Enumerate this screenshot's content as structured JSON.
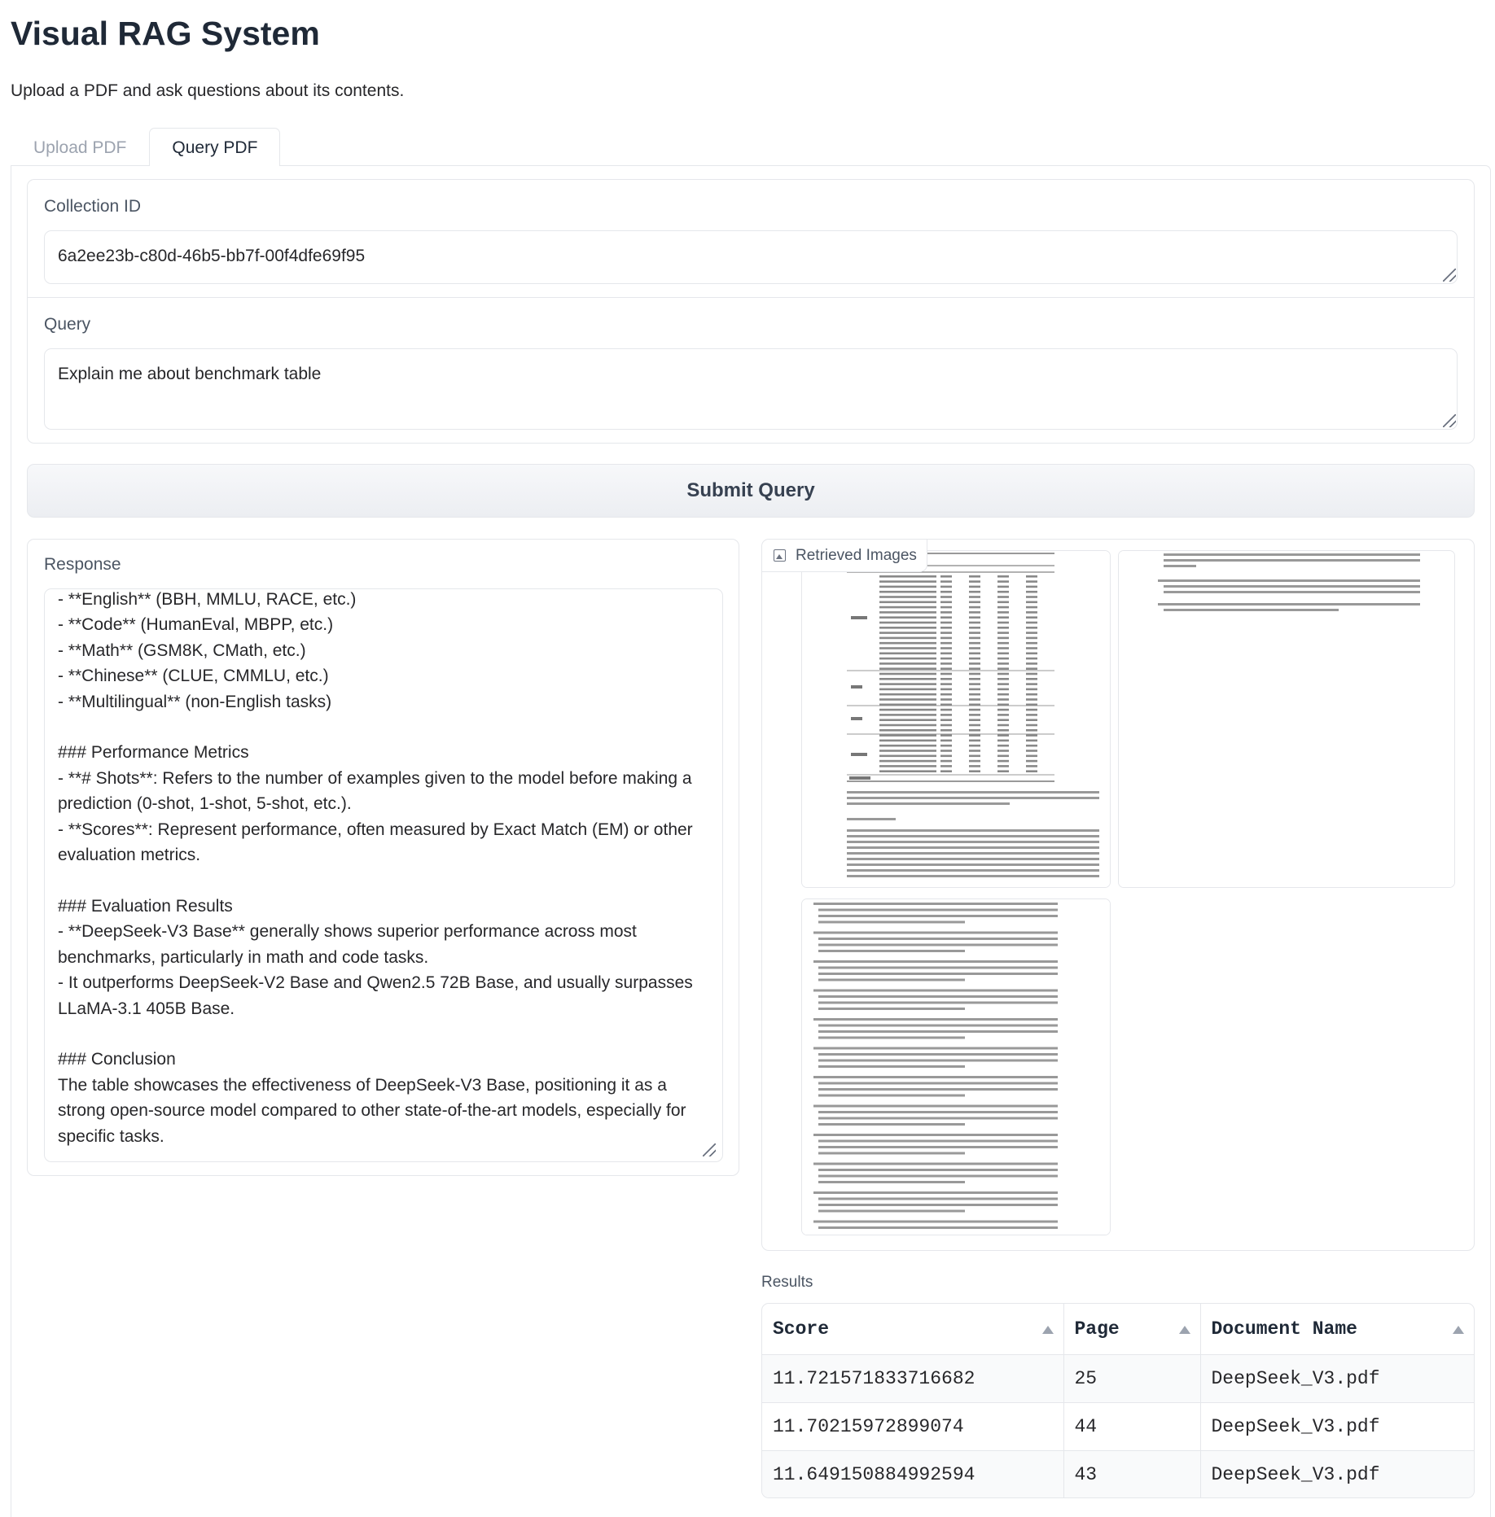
{
  "app": {
    "title": "Visual RAG System",
    "description": "Upload a PDF and ask questions about its contents."
  },
  "tabs": [
    {
      "label": "Upload PDF",
      "active": false
    },
    {
      "label": "Query PDF",
      "active": true
    }
  ],
  "form": {
    "collection_label": "Collection ID",
    "collection_value": "6a2ee23b-c80d-46b5-bb7f-00f4dfe69f95",
    "query_label": "Query",
    "query_value": "Explain me about benchmark table",
    "submit_label": "Submit Query"
  },
  "response": {
    "label": "Response",
    "text": "- **English** (BBH, MMLU, RACE, etc.)\n- **Code** (HumanEval, MBPP, etc.)\n- **Math** (GSM8K, CMath, etc.)\n- **Chinese** (CLUE, CMMLU, etc.)\n- **Multilingual** (non-English tasks)\n\n### Performance Metrics\n- **# Shots**: Refers to the number of examples given to the model before making a prediction (0-shot, 1-shot, 5-shot, etc.).\n- **Scores**: Represent performance, often measured by Exact Match (EM) or other evaluation metrics.\n\n### Evaluation Results\n- **DeepSeek-V3 Base** generally shows superior performance across most benchmarks, particularly in math and code tasks.\n- It outperforms DeepSeek-V2 Base and Qwen2.5 72B Base, and usually surpasses LLaMA-3.1 405B Base.\n\n### Conclusion\nThe table showcases the effectiveness of DeepSeek-V3 Base, positioning it as a strong open-source model compared to other state-of-the-art models, especially for specific tasks."
  },
  "gallery": {
    "label": "Retrieved Images",
    "icon": "image-icon"
  },
  "results": {
    "label": "Results",
    "columns": [
      "Score",
      "Page",
      "Document Name"
    ],
    "rows": [
      [
        "11.721571833716682",
        "25",
        "DeepSeek_V3.pdf"
      ],
      [
        "11.70215972899074",
        "44",
        "DeepSeek_V3.pdf"
      ],
      [
        "11.649150884992594",
        "43",
        "DeepSeek_V3.pdf"
      ]
    ]
  }
}
